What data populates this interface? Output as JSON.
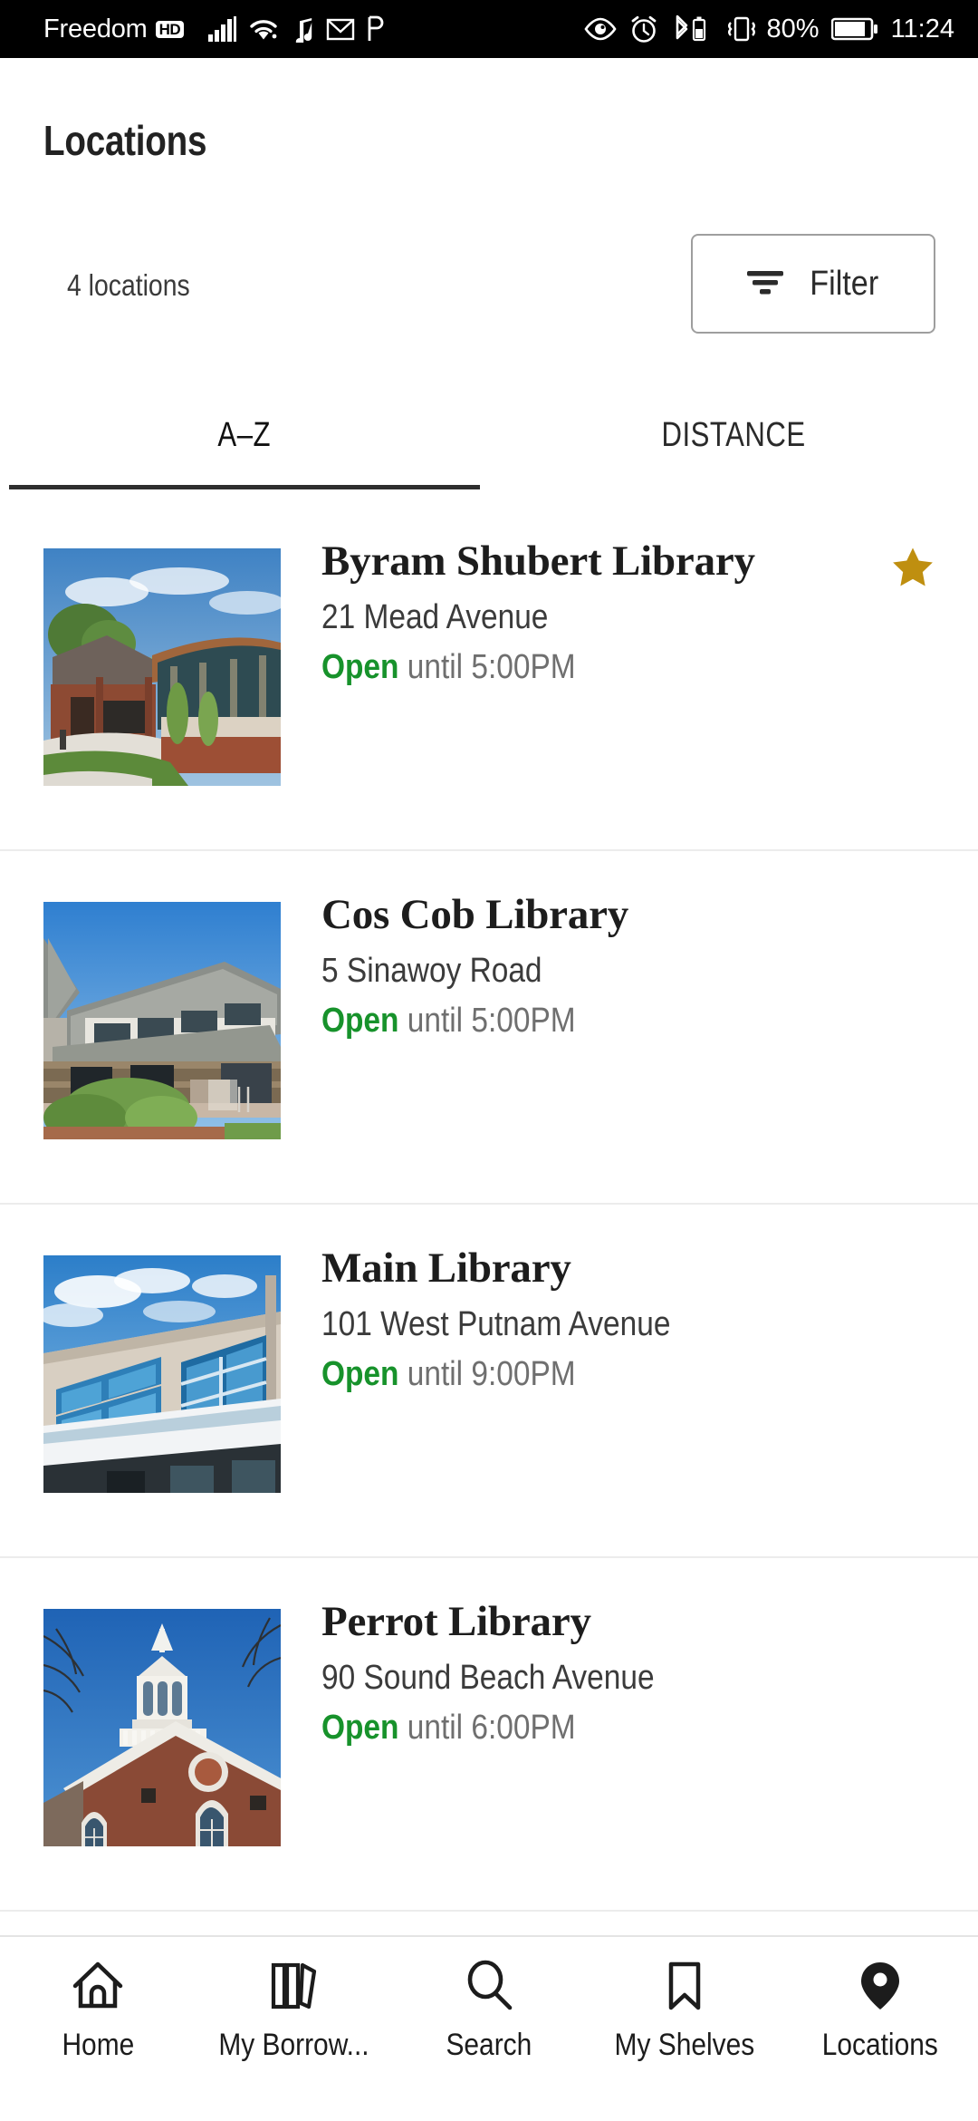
{
  "statusbar": {
    "carrier": "Freedom",
    "hd_badge": "HD",
    "battery_percent": "80%",
    "time": "11:24",
    "left_icons": [
      "signal-bars-icon",
      "wifi-icon",
      "music-note-icon",
      "mail-icon",
      "p-letter-icon"
    ],
    "right_icons": [
      "eye-icon",
      "alarm-clock-icon",
      "bluetooth-battery-icon",
      "vibrate-icon",
      "battery-icon"
    ]
  },
  "header": {
    "title": "Locations",
    "count_label": "4 locations",
    "filter_label": "Filter"
  },
  "tabs": [
    {
      "label": "A–Z",
      "active": true
    },
    {
      "label": "DISTANCE",
      "active": false
    }
  ],
  "colors": {
    "open_green": "#17922b",
    "star_gold": "#bf8f10",
    "divider": "#ececec",
    "text_primary": "#1d1d1d",
    "text_secondary": "#6f6f6f"
  },
  "locations": [
    {
      "name": "Byram Shubert Library",
      "address": "21 Mead Avenue",
      "status": "Open",
      "hours": " until 5:00PM",
      "favorite": true,
      "thumb": "byram-shubert-library-photo"
    },
    {
      "name": "Cos Cob Library",
      "address": "5 Sinawoy Road",
      "status": "Open",
      "hours": " until 5:00PM",
      "favorite": false,
      "thumb": "cos-cob-library-photo"
    },
    {
      "name": "Main Library",
      "address": "101 West Putnam Avenue",
      "status": "Open",
      "hours": " until 9:00PM",
      "favorite": false,
      "thumb": "main-library-photo"
    },
    {
      "name": "Perrot Library",
      "address": "90 Sound Beach Avenue",
      "status": "Open",
      "hours": " until 6:00PM",
      "favorite": false,
      "thumb": "perrot-library-photo"
    }
  ],
  "bottom_nav": [
    {
      "label": "Home",
      "icon": "home-icon",
      "active": false
    },
    {
      "label": "My Borrow...",
      "icon": "books-icon",
      "active": false
    },
    {
      "label": "Search",
      "icon": "search-icon",
      "active": false
    },
    {
      "label": "My Shelves",
      "icon": "bookmark-icon",
      "active": false
    },
    {
      "label": "Locations",
      "icon": "map-pin-icon",
      "active": true
    }
  ]
}
